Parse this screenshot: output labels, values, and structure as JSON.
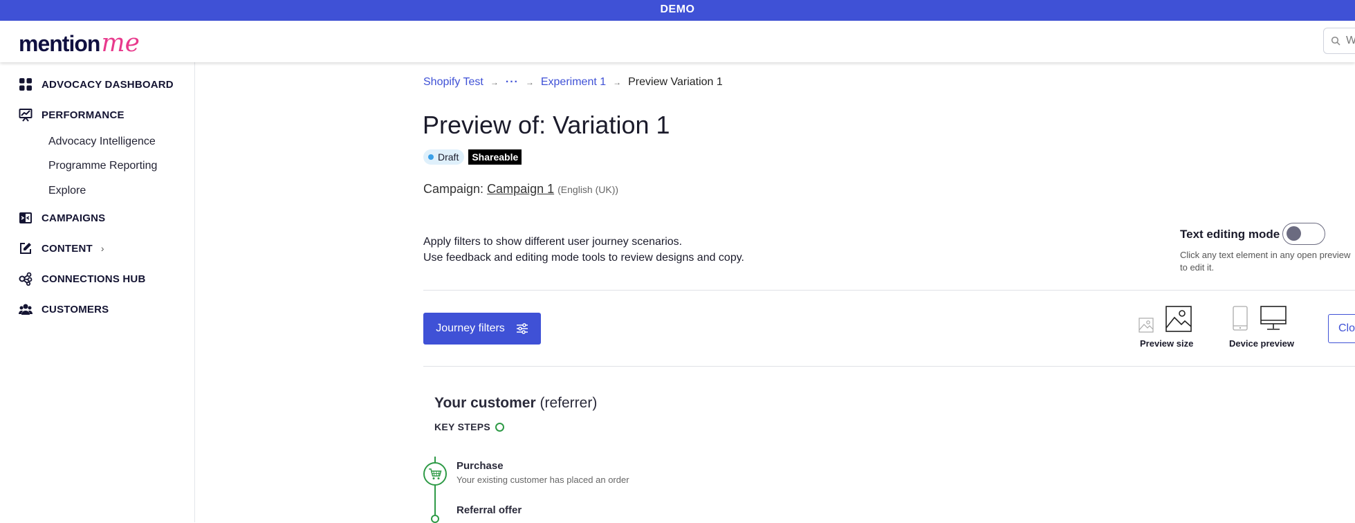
{
  "demo_banner": "DEMO",
  "logo": {
    "part1": "mention",
    "part2": "me"
  },
  "search": {
    "placeholder": "W"
  },
  "sidebar": {
    "items": [
      {
        "label": "ADVOCACY DASHBOARD",
        "icon": "dashboard-grid-icon"
      },
      {
        "label": "PERFORMANCE",
        "icon": "performance-chart-icon"
      },
      {
        "label": "CAMPAIGNS",
        "icon": "campaigns-icon"
      },
      {
        "label": "CONTENT",
        "icon": "edit-icon"
      },
      {
        "label": "CONNECTIONS HUB",
        "icon": "connections-icon"
      },
      {
        "label": "CUSTOMERS",
        "icon": "customers-icon"
      }
    ],
    "performance_sub": [
      "Advocacy Intelligence",
      "Programme Reporting",
      "Explore"
    ]
  },
  "breadcrumb": {
    "items": [
      "Shopify Test",
      "···",
      "Experiment 1",
      "Preview Variation 1"
    ]
  },
  "page": {
    "title": "Preview of: Variation 1",
    "badge_draft": "Draft",
    "badge_shareable": "Shareable",
    "campaign_label": "Campaign:",
    "campaign_name": "Campaign 1",
    "campaign_language": "(English (UK))",
    "description_line1": "Apply filters to show different user journey scenarios.",
    "description_line2": "Use feedback and editing mode tools to review designs and copy."
  },
  "text_editing": {
    "label": "Text editing mode",
    "enabled": false,
    "help": "Click any text element in any open preview to edit it."
  },
  "toolbar": {
    "journey_filters_label": "Journey filters",
    "preview_size_label": "Preview size",
    "device_preview_label": "Device preview",
    "close_label": "Clos"
  },
  "journey": {
    "title_bold": "Your customer",
    "title_rest": "(referrer)",
    "key_steps_label": "KEY STEPS",
    "steps": [
      {
        "title": "Purchase",
        "description": "Your existing customer has placed an order"
      },
      {
        "title": "Referral offer",
        "description": ""
      }
    ]
  },
  "colors": {
    "primary": "#3f51d6",
    "brand_pink": "#e8398c",
    "success_green": "#2e9a46"
  }
}
